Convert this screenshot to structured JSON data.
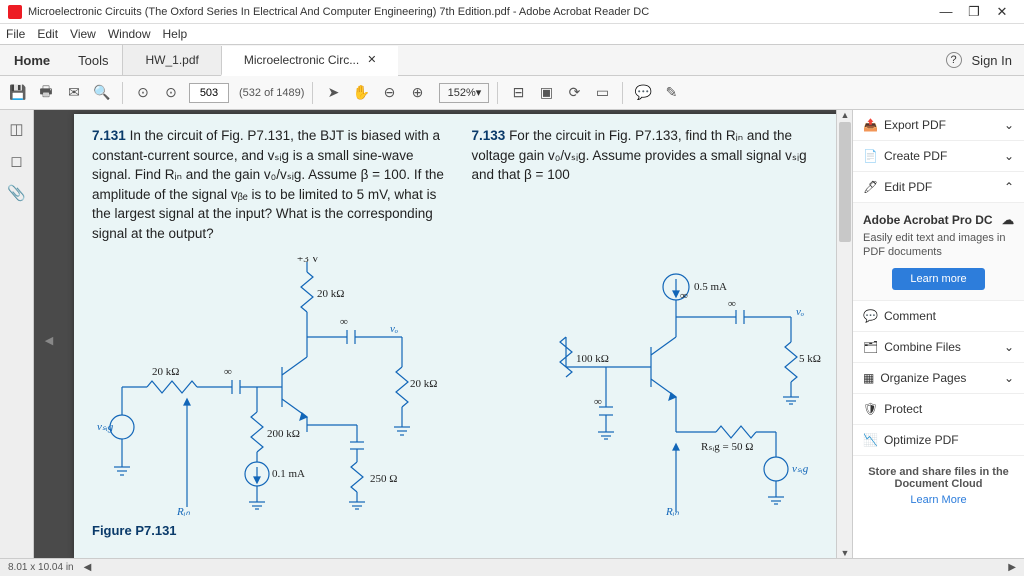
{
  "window": {
    "title": "Microelectronic Circuits (The Oxford Series In Electrical And Computer Engineering) 7th Edition.pdf - Adobe Acrobat Reader DC",
    "min": "—",
    "max": "❐",
    "close": "✕"
  },
  "menu": {
    "file": "File",
    "edit": "Edit",
    "view": "View",
    "window": "Window",
    "help": "Help"
  },
  "tabs": {
    "home": "Home",
    "tools": "Tools",
    "doc1": "HW_1.pdf",
    "doc2": "Microelectronic Circ...",
    "signin": "Sign In",
    "help": "?"
  },
  "toolbar": {
    "page_current": "503",
    "page_total": "(532 of 1489)",
    "zoom": "152%"
  },
  "document": {
    "p131_num": "7.131",
    "p131_text": "In the circuit of Fig. P7.131, the BJT is biased with a constant-current source, and vₛᵢg is a small sine-wave signal. Find Rᵢₙ and the gain v₀/vₛᵢg. Assume β = 100. If the amplitude of the signal vᵦₑ is to be limited to 5 mV, what is the largest signal at the input? What is the corresponding signal at the output?",
    "p133_num": "7.133",
    "p133_text": "For the circuit in Fig. P7.133, find th Rᵢₙ and the voltage gain v₀/vₛᵢg. Assume provides a small signal vₛᵢg and that β = 100",
    "fig_caption": "Figure P7.131",
    "fig131": {
      "vplus": "+3 V",
      "r_top": "20 kΩ",
      "r_in": "20 kΩ",
      "r_c": "20 kΩ",
      "r_b": "200 kΩ",
      "r_e": "250 Ω",
      "i_bias": "0.1 mA",
      "vo": "vₒ",
      "vsig": "vₛᵢg",
      "rin_lbl": "Rᵢₙ"
    },
    "fig133": {
      "i_src": "0.5 mA",
      "r_c": "100 kΩ",
      "r_l": "5 kΩ",
      "r_sig": "Rₛᵢg = 50 Ω",
      "vo": "vₒ",
      "vsig": "vₛᵢg",
      "rin_lbl": "Rᵢₙ"
    }
  },
  "rpanel": {
    "export": "Export PDF",
    "create": "Create PDF",
    "edit": "Edit PDF",
    "promo_title": "Adobe Acrobat Pro DC",
    "promo_text": "Easily edit text and images in PDF documents",
    "learn": "Learn more",
    "comment": "Comment",
    "combine": "Combine Files",
    "organize": "Organize Pages",
    "protect": "Protect",
    "optimize": "Optimize PDF",
    "cloud_text": "Store and share files in the Document Cloud",
    "cloud_link": "Learn More"
  },
  "status": {
    "dim": "8.01 x 10.04 in"
  }
}
